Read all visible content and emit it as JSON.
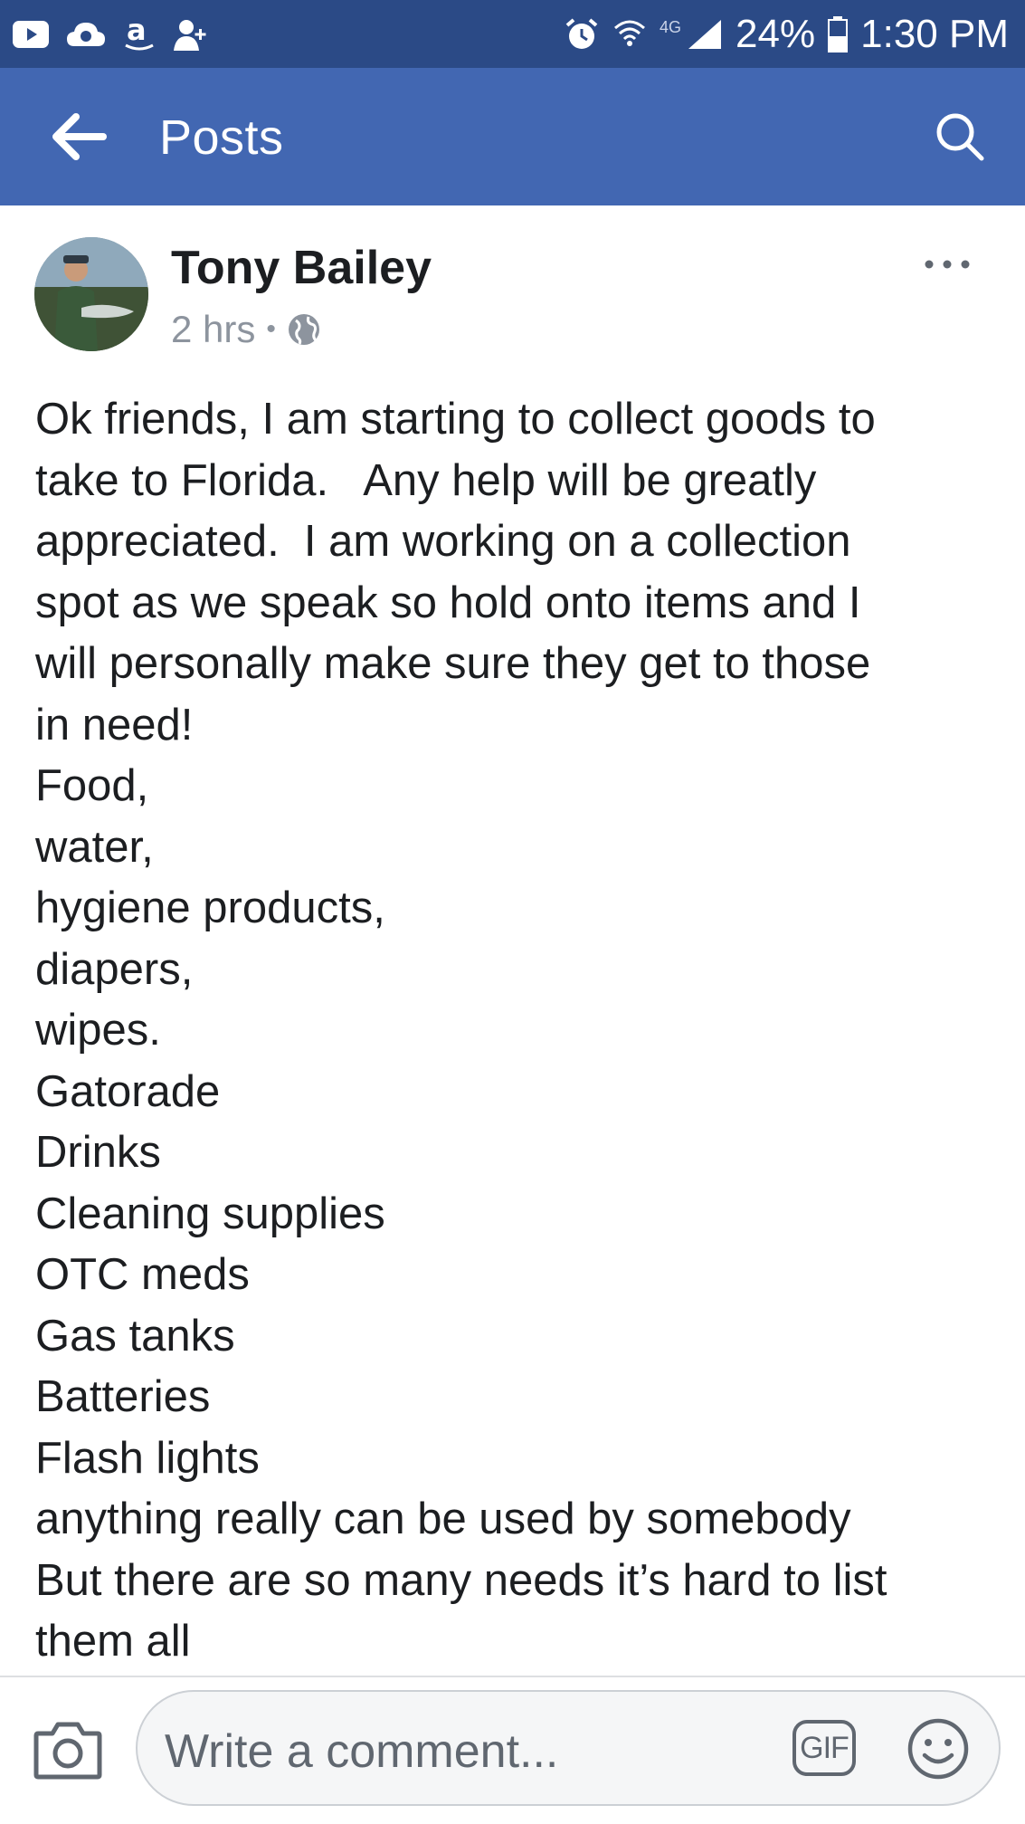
{
  "status_bar": {
    "left_icons": [
      "youtube-icon",
      "cloud-icon",
      "amazon-icon",
      "add-contact-icon"
    ],
    "network_label": "4G",
    "battery_percent": "24%",
    "time": "1:30 PM"
  },
  "app_bar": {
    "title": "Posts"
  },
  "post": {
    "author": "Tony Bailey",
    "time_ago": "2 hrs",
    "separator": "•",
    "audience_icon": "globe-icon",
    "body_lines": [
      "Ok friends, I am starting to collect goods to",
      "take to Florida.   Any help will be greatly",
      "appreciated.  I am working on a collection",
      "spot as we speak so hold onto items and I",
      "will personally make sure they get to those",
      "in need!",
      "Food,",
      "water,",
      "hygiene products,",
      "diapers,",
      "wipes.",
      "Gatorade",
      "Drinks",
      "Cleaning supplies",
      "OTC meds",
      "Gas tanks",
      "Batteries",
      "Flash lights",
      "anything really can be used by somebody",
      "But there are so many needs it’s hard to list",
      "them all"
    ]
  },
  "comment_bar": {
    "placeholder": "Write a comment...",
    "gif_label": "GIF"
  }
}
